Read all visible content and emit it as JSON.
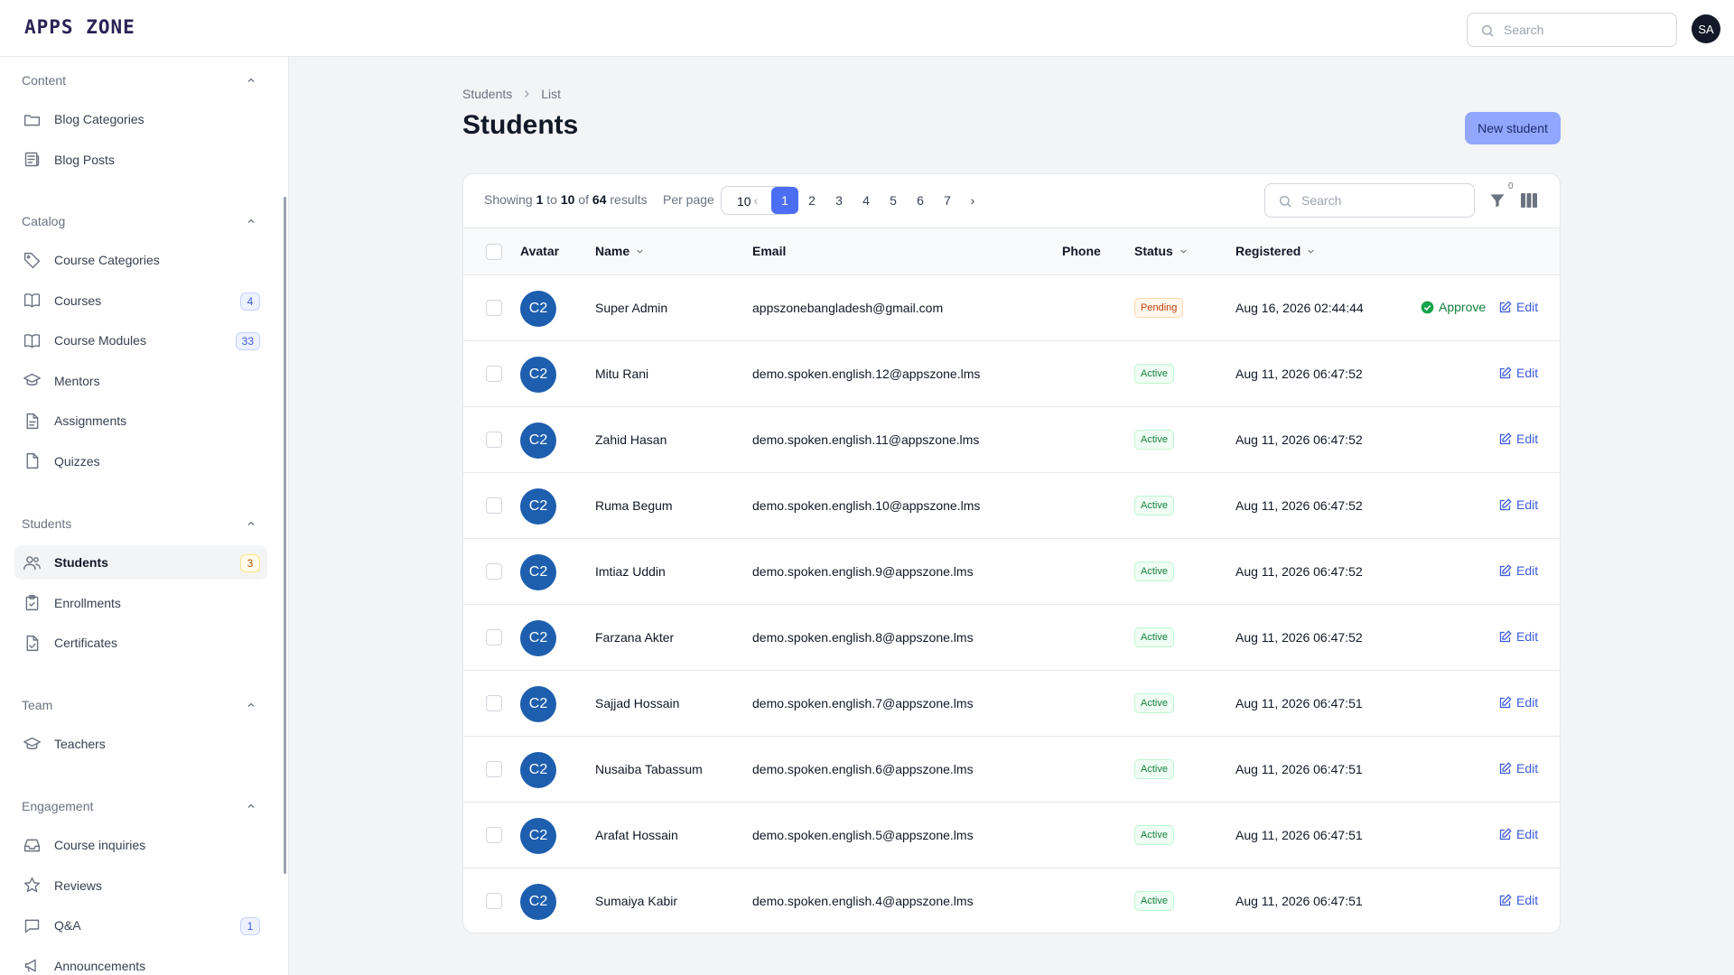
{
  "app": {
    "logo": "APPS ZONE",
    "search_placeholder": "Search",
    "user_initials": "SA"
  },
  "sidebar": {
    "groups": [
      {
        "title": "Content",
        "items": [
          {
            "label": "Blog Categories",
            "icon": "folder-icon"
          },
          {
            "label": "Blog Posts",
            "icon": "newspaper-icon"
          }
        ]
      },
      {
        "title": "Catalog",
        "items": [
          {
            "label": "Course Categories",
            "icon": "tag-icon"
          },
          {
            "label": "Courses",
            "icon": "book-open-icon",
            "badge": "4"
          },
          {
            "label": "Course Modules",
            "icon": "book-open-icon",
            "badge": "33"
          },
          {
            "label": "Mentors",
            "icon": "academic-cap-icon"
          },
          {
            "label": "Assignments",
            "icon": "document-text-icon"
          },
          {
            "label": "Quizzes",
            "icon": "document-icon"
          }
        ]
      },
      {
        "title": "Students",
        "items": [
          {
            "label": "Students",
            "icon": "users-icon",
            "badge": "3",
            "active": true
          },
          {
            "label": "Enrollments",
            "icon": "clipboard-icon"
          },
          {
            "label": "Certificates",
            "icon": "document-check-icon"
          }
        ]
      },
      {
        "title": "Team",
        "items": [
          {
            "label": "Teachers",
            "icon": "academic-cap-icon"
          }
        ]
      },
      {
        "title": "Engagement",
        "items": [
          {
            "label": "Course inquiries",
            "icon": "inbox-icon"
          },
          {
            "label": "Reviews",
            "icon": "star-icon"
          },
          {
            "label": "Q&A",
            "icon": "chat-icon",
            "badge": "1"
          },
          {
            "label": "Announcements",
            "icon": "megaphone-icon"
          }
        ]
      }
    ]
  },
  "breadcrumb": {
    "parent": "Students",
    "current": "List"
  },
  "page": {
    "title": "Students",
    "new_button": "New student"
  },
  "toolbar": {
    "showing_prefix": "Showing",
    "from": "1",
    "to_word": "to",
    "to": "10",
    "of_word": "of",
    "total": "64",
    "results_word": "results",
    "per_page_label": "Per page",
    "per_page_value": "10",
    "pages": [
      "1",
      "2",
      "3",
      "4",
      "5",
      "6",
      "7"
    ],
    "current_page": "1",
    "prev": "‹",
    "next": "›",
    "search_placeholder": "Search",
    "filter_count": "0"
  },
  "table": {
    "columns": {
      "avatar": "Avatar",
      "name": "Name",
      "email": "Email",
      "phone": "Phone",
      "status": "Status",
      "registered": "Registered"
    },
    "approve_label": "Approve",
    "edit_label": "Edit",
    "rows": [
      {
        "initials": "C2",
        "name": "Super Admin",
        "email": "appszonebangladesh@gmail.com",
        "phone": "",
        "status": "Pending",
        "registered": "Aug 16, 2026 02:44:44",
        "can_approve": true
      },
      {
        "initials": "C2",
        "name": "Mitu Rani",
        "email": "demo.spoken.english.12@appszone.lms",
        "phone": "",
        "status": "Active",
        "registered": "Aug 11, 2026 06:47:52",
        "can_approve": false
      },
      {
        "initials": "C2",
        "name": "Zahid Hasan",
        "email": "demo.spoken.english.11@appszone.lms",
        "phone": "",
        "status": "Active",
        "registered": "Aug 11, 2026 06:47:52",
        "can_approve": false
      },
      {
        "initials": "C2",
        "name": "Ruma Begum",
        "email": "demo.spoken.english.10@appszone.lms",
        "phone": "",
        "status": "Active",
        "registered": "Aug 11, 2026 06:47:52",
        "can_approve": false
      },
      {
        "initials": "C2",
        "name": "Imtiaz Uddin",
        "email": "demo.spoken.english.9@appszone.lms",
        "phone": "",
        "status": "Active",
        "registered": "Aug 11, 2026 06:47:52",
        "can_approve": false
      },
      {
        "initials": "C2",
        "name": "Farzana Akter",
        "email": "demo.spoken.english.8@appszone.lms",
        "phone": "",
        "status": "Active",
        "registered": "Aug 11, 2026 06:47:52",
        "can_approve": false
      },
      {
        "initials": "C2",
        "name": "Sajjad Hossain",
        "email": "demo.spoken.english.7@appszone.lms",
        "phone": "",
        "status": "Active",
        "registered": "Aug 11, 2026 06:47:51",
        "can_approve": false
      },
      {
        "initials": "C2",
        "name": "Nusaiba Tabassum",
        "email": "demo.spoken.english.6@appszone.lms",
        "phone": "",
        "status": "Active",
        "registered": "Aug 11, 2026 06:47:51",
        "can_approve": false
      },
      {
        "initials": "C2",
        "name": "Arafat Hossain",
        "email": "demo.spoken.english.5@appszone.lms",
        "phone": "",
        "status": "Active",
        "registered": "Aug 11, 2026 06:47:51",
        "can_approve": false
      },
      {
        "initials": "C2",
        "name": "Sumaiya Kabir",
        "email": "demo.spoken.english.4@appszone.lms",
        "phone": "",
        "status": "Active",
        "registered": "Aug 11, 2026 06:47:51",
        "can_approve": false
      }
    ]
  },
  "colors": {
    "accent": "#4c6ef5",
    "avatar": "#1e5eae",
    "active_bg": "#f0fdf4",
    "active_text": "#15803d",
    "pending_bg": "#fff7ed",
    "pending_text": "#c2410c"
  }
}
